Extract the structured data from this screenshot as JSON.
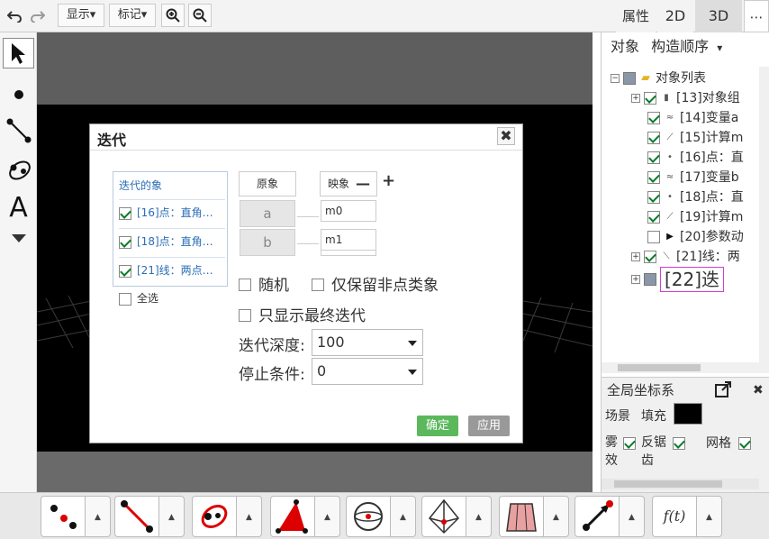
{
  "toolbar": {
    "undo_icon": "undo-icon",
    "redo_icon": "redo-icon",
    "display_menu": "显示▾",
    "label_menu": "标记▾",
    "zoom_in_icon": "zoom-in-icon",
    "zoom_out_icon": "zoom-out-icon",
    "properties": "属性",
    "view_2d": "2D",
    "view_3d": "3D",
    "more": "⋯"
  },
  "left_tools": [
    {
      "name": "move-tool",
      "glyph": "➤"
    },
    {
      "name": "point-tool",
      "glyph": "●"
    },
    {
      "name": "segment-tool",
      "glyph": "⟋"
    },
    {
      "name": "circle-tool",
      "glyph": "◎"
    },
    {
      "name": "text-tool",
      "glyph": "A"
    },
    {
      "name": "more-tools",
      "glyph": "▼"
    }
  ],
  "right_panel": {
    "tab_objects": "对象",
    "tab_order": "构造顺序",
    "tab_caret": "▾",
    "tree": [
      {
        "indent": 0,
        "expander": "−",
        "checkbox": "gray",
        "icon": "📁",
        "label": "对象列表"
      },
      {
        "indent": 1,
        "expander": "+",
        "checkbox": "on",
        "icon": "▮",
        "label": "[13]对象组"
      },
      {
        "indent": 2,
        "expander": "",
        "checkbox": "on",
        "icon": "≈",
        "label": "[14]变量a"
      },
      {
        "indent": 2,
        "expander": "",
        "checkbox": "on",
        "icon": "⟋",
        "label": "[15]计算m"
      },
      {
        "indent": 2,
        "expander": "",
        "checkbox": "on",
        "icon": "•",
        "label": "[16]点：直"
      },
      {
        "indent": 2,
        "expander": "",
        "checkbox": "on",
        "icon": "≈",
        "label": "[17]变量b"
      },
      {
        "indent": 2,
        "expander": "",
        "checkbox": "on",
        "icon": "•",
        "label": "[18]点：直"
      },
      {
        "indent": 2,
        "expander": "",
        "checkbox": "on",
        "icon": "⟋",
        "label": "[19]计算m"
      },
      {
        "indent": 2,
        "expander": "",
        "checkbox": "off",
        "icon": "▶",
        "label": "[20]参数动"
      },
      {
        "indent": 1,
        "expander": "+",
        "checkbox": "on",
        "icon": "⟍",
        "label": "[21]线：两"
      },
      {
        "indent": 1,
        "expander": "+",
        "checkbox": "gray",
        "icon": "",
        "label": "[22]迭"
      }
    ],
    "coord_title": "全局坐标系",
    "scene_label": "场景",
    "fill_label": "填充",
    "fog_label": "雾效",
    "antialias_label": "反锯齿",
    "grid_label": "网格"
  },
  "dialog": {
    "title": "迭代",
    "close": "✖",
    "iter_header": "迭代的象",
    "iter_items": [
      "[16]点：直角…",
      "[18]点：直角…",
      "[21]线：两点…"
    ],
    "select_all": "全选",
    "col_source": "原象",
    "col_image": "映象",
    "minus": "—",
    "plus": "+",
    "sources": [
      "a",
      "b"
    ],
    "images": [
      "m0",
      "m1"
    ],
    "opt_random": "随机",
    "opt_keep_nonpoint": "仅保留非点类象",
    "opt_show_final": "只显示最终迭代",
    "depth_label": "迭代深度:",
    "depth_value": "100",
    "stop_label": "停止条件:",
    "stop_value": "0",
    "ok": "确定",
    "apply": "应用"
  },
  "bottom_tools": [
    {
      "name": "point-tools-group"
    },
    {
      "name": "line-tools-group"
    },
    {
      "name": "circle-tools-group"
    },
    {
      "name": "polygon-tools-group"
    },
    {
      "name": "sphere-tools-group"
    },
    {
      "name": "solid-tools-group"
    },
    {
      "name": "prism-tools-group"
    },
    {
      "name": "vector-tools-group"
    },
    {
      "name": "function-tools-group",
      "label": "f(t)"
    }
  ],
  "colors": {
    "ok_green": "#5cb85c",
    "apply_gray": "#999999",
    "link_blue": "#2a6db5",
    "check_green": "#0a7a2a"
  }
}
